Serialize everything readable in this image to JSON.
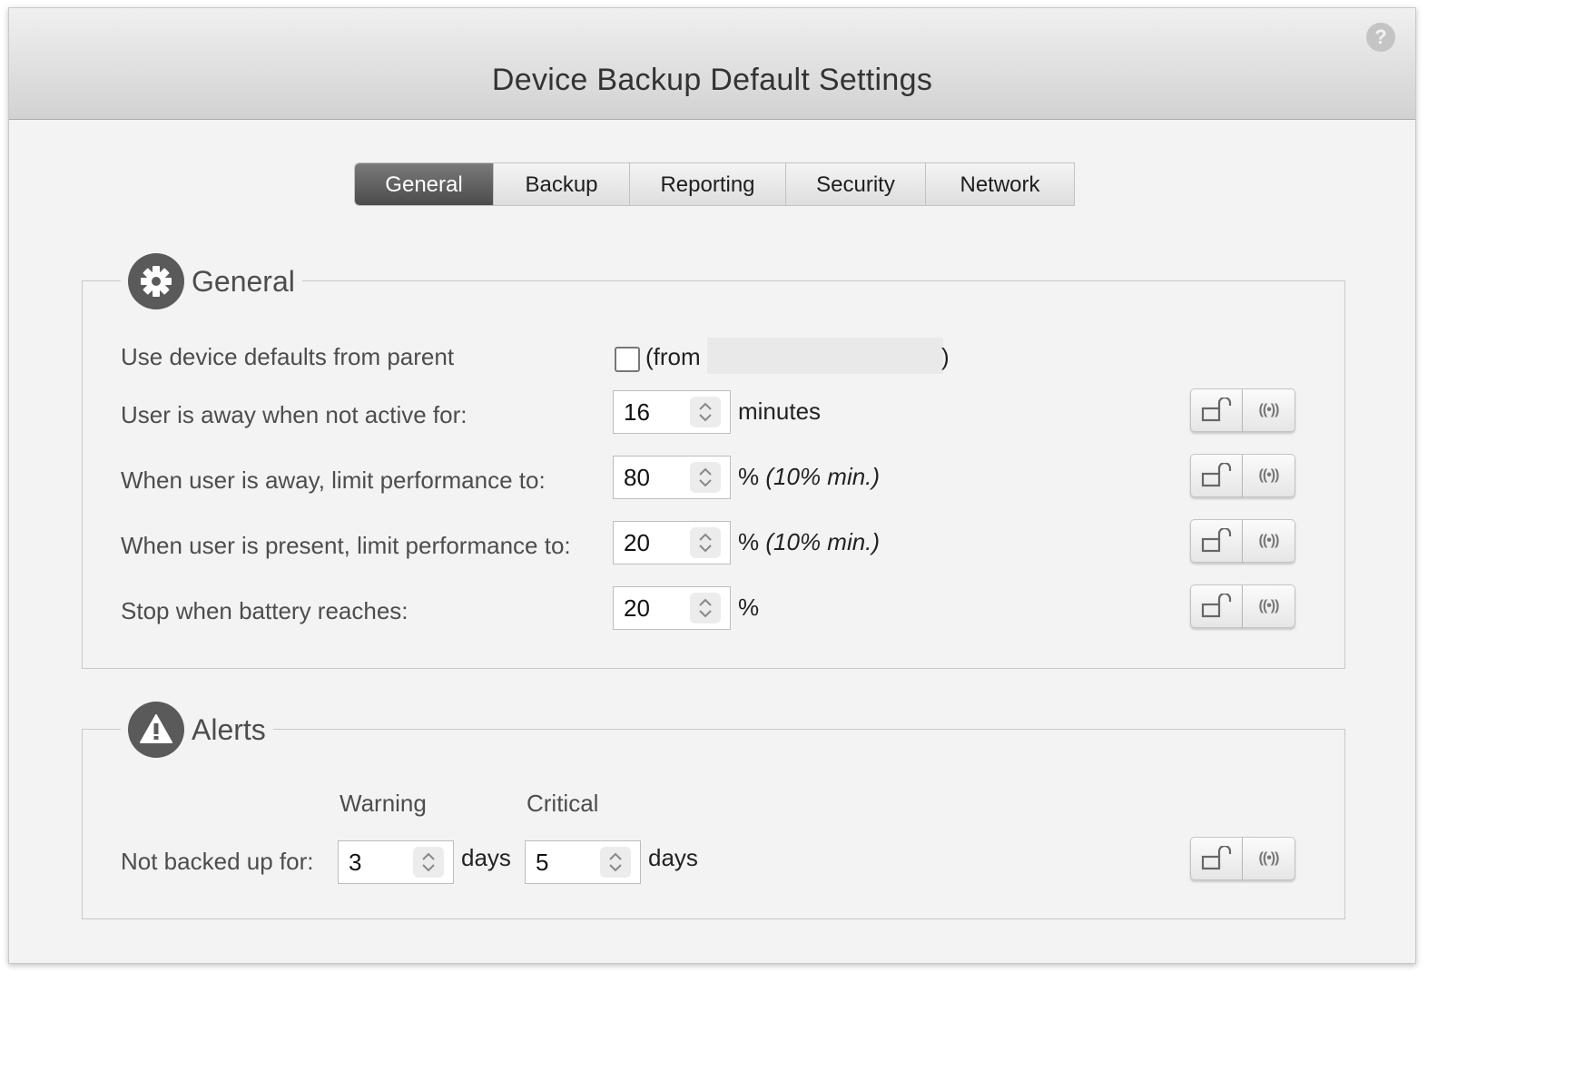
{
  "window": {
    "title": "Device Backup Default Settings",
    "help_symbol": "?"
  },
  "tabs": [
    {
      "label": "General",
      "active": true
    },
    {
      "label": "Backup",
      "active": false
    },
    {
      "label": "Reporting",
      "active": false
    },
    {
      "label": "Security",
      "active": false
    },
    {
      "label": "Network",
      "active": false
    }
  ],
  "general": {
    "heading": "General",
    "icon": "gear-icon",
    "parent_defaults": {
      "label": "Use device defaults from parent",
      "checked": false,
      "from_prefix": "(from",
      "from_suffix": ")"
    },
    "away": {
      "label": "User is away when not active for:",
      "value": "16",
      "unit": "minutes"
    },
    "away_limit": {
      "label": "When user is away, limit performance to:",
      "value": "80",
      "unit": "%",
      "note": "(10% min.)"
    },
    "present_limit": {
      "label": "When user is present, limit performance to:",
      "value": "20",
      "unit": "%",
      "note": "(10% min.)"
    },
    "battery": {
      "label": "Stop when battery reaches:",
      "value": "20",
      "unit": "%"
    }
  },
  "alerts": {
    "heading": "Alerts",
    "icon": "warning-icon",
    "warning_header": "Warning",
    "critical_header": "Critical",
    "not_backed": {
      "label": "Not backed up for:",
      "warning_value": "3",
      "warning_unit": "days",
      "critical_value": "5",
      "critical_unit": "days"
    }
  },
  "colors": {
    "active_tab": "#555555",
    "legend_icon": "#5a5a5a"
  }
}
